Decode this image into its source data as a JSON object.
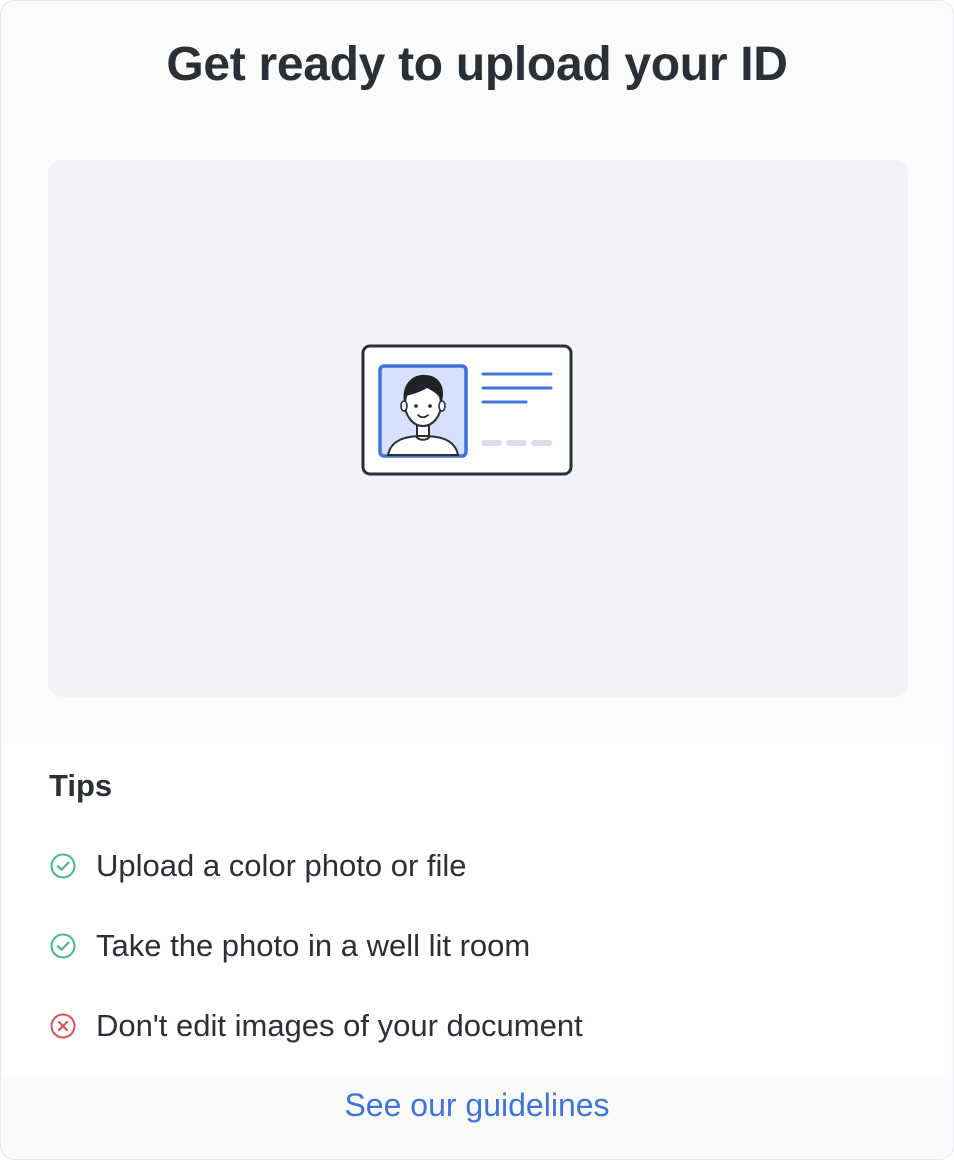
{
  "header": {
    "title": "Get ready to upload your ID"
  },
  "illustration": {
    "icon": "id-card-illustration",
    "colors": {
      "panel_bg": "#f1f3f8",
      "card_border": "#2b2f36",
      "photo_bg": "#d6e1fb",
      "accent": "#3f74d6",
      "dash": "#d8def0"
    }
  },
  "tips": {
    "heading": "Tips",
    "items": [
      {
        "text": "Upload a color photo or file",
        "icon": "check-circle-icon",
        "status": "do",
        "color": "#4fb392"
      },
      {
        "text": "Take the photo in a well lit room",
        "icon": "check-circle-icon",
        "status": "do",
        "color": "#4fb392"
      },
      {
        "text": "Don't edit images of your document",
        "icon": "x-circle-icon",
        "status": "dont",
        "color": "#d6545a"
      }
    ]
  },
  "footer": {
    "link_label": "See our guidelines",
    "link_color": "#3f74d6"
  }
}
